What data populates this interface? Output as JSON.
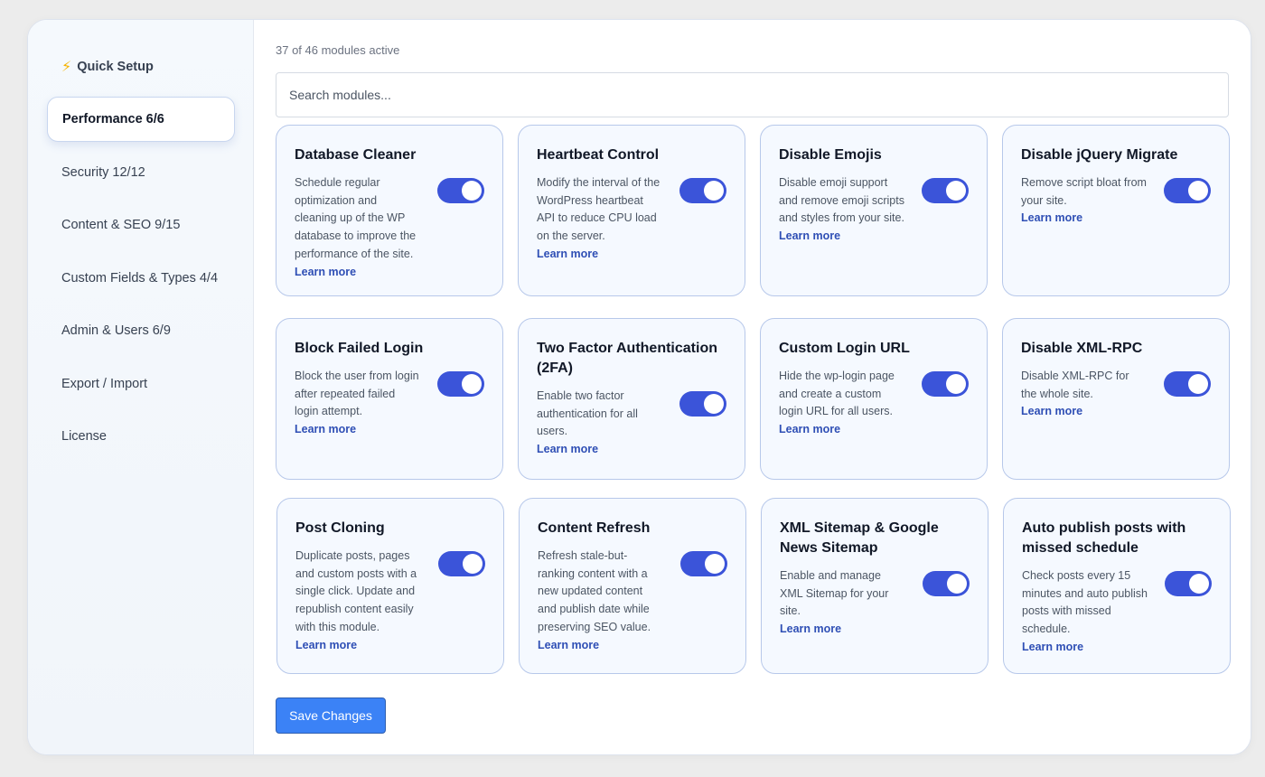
{
  "sidebar": {
    "quick_setup": "Quick Setup",
    "items": [
      {
        "label": "Performance 6/6"
      },
      {
        "label": "Security 12/12"
      },
      {
        "label": "Content & SEO 9/15"
      },
      {
        "label": "Custom Fields & Types 4/4"
      },
      {
        "label": "Admin & Users 6/9"
      },
      {
        "label": "Export / Import"
      },
      {
        "label": "License"
      }
    ]
  },
  "main": {
    "module_count": "37 of 46 modules active",
    "search_placeholder": "Search modules...",
    "learn_more": "Learn more",
    "save_label": "Save Changes",
    "modules": [
      {
        "title": "Database Cleaner",
        "desc": "Schedule regular optimization and cleaning up of the WP database to improve the performance of the site.",
        "enabled": true
      },
      {
        "title": "Heartbeat Control",
        "desc": "Modify the interval of the WordPress heartbeat API to reduce CPU load on the server.",
        "enabled": true
      },
      {
        "title": "Disable Emojis",
        "desc": "Disable emoji support and remove emoji scripts and styles from your site.",
        "enabled": true
      },
      {
        "title": "Disable jQuery Migrate",
        "desc": "Remove script bloat from your site.",
        "enabled": true
      },
      {
        "title": "Block Failed Login",
        "desc": "Block the user from login after repeated failed login attempt.",
        "enabled": true
      },
      {
        "title": "Two Factor Authentication (2FA)",
        "desc": "Enable two factor authentication for all users.",
        "enabled": true
      },
      {
        "title": "Custom Login URL",
        "desc": "Hide the wp-login page and create a custom login URL for all users.",
        "enabled": true
      },
      {
        "title": "Disable XML-RPC",
        "desc": "Disable XML-RPC for the whole site.",
        "enabled": true
      },
      {
        "title": "Post Cloning",
        "desc": "Duplicate posts, pages and custom posts with a single click. Update and republish content easily with this module.",
        "enabled": true
      },
      {
        "title": "Content Refresh",
        "desc": "Refresh stale-but-ranking content with a new updated content and publish date while preserving SEO value.",
        "enabled": true
      },
      {
        "title": "XML Sitemap & Google News Sitemap",
        "desc": "Enable and manage XML Sitemap for your site.",
        "enabled": true
      },
      {
        "title": "Auto publish posts with missed schedule",
        "desc": "Check posts every 15 minutes and auto publish posts with missed schedule.",
        "enabled": true
      }
    ]
  },
  "colors": {
    "toggle_on": "#3b54d9",
    "card_border": "#b7c8ea",
    "save_button": "#3b82f6",
    "link": "#2f4fb5"
  }
}
